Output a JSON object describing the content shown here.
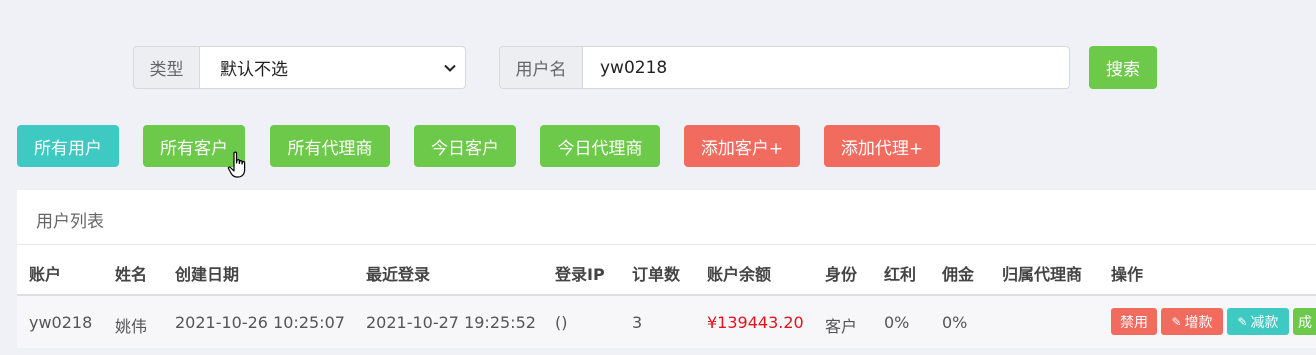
{
  "filters": {
    "type_label": "类型",
    "type_value": "默认不选",
    "username_label": "用户名",
    "username_value": "yw0218",
    "search_button": "搜索"
  },
  "actions": [
    {
      "label": "所有用户",
      "color": "#3ec9c2"
    },
    {
      "label": "所有客户",
      "color": "#6cc94a"
    },
    {
      "label": "所有代理商",
      "color": "#6cc94a"
    },
    {
      "label": "今日客户",
      "color": "#6cc94a"
    },
    {
      "label": "今日代理商",
      "color": "#6cc94a"
    },
    {
      "label": "添加客户+",
      "color": "#f26b5f"
    },
    {
      "label": "添加代理+",
      "color": "#f26b5f"
    }
  ],
  "panel": {
    "title": "用户列表",
    "columns": [
      "账户",
      "姓名",
      "创建日期",
      "最近登录",
      "登录IP",
      "订单数",
      "账户余额",
      "身份",
      "红利",
      "佣金",
      "归属代理商",
      "操作"
    ],
    "rows": [
      {
        "account": "yw0218",
        "name": "姚伟",
        "created": "2021-10-26 10:25:07",
        "last_login": "2021-10-27 19:25:52",
        "login_ip": "()",
        "orders": "3",
        "balance": "¥139443.20",
        "role": "客户",
        "bonus": "0%",
        "commission": "0%",
        "agent": "",
        "ops": {
          "disable": "禁用",
          "add_funds": "增款",
          "reduce_funds": "减款",
          "more": "成"
        }
      }
    ]
  }
}
